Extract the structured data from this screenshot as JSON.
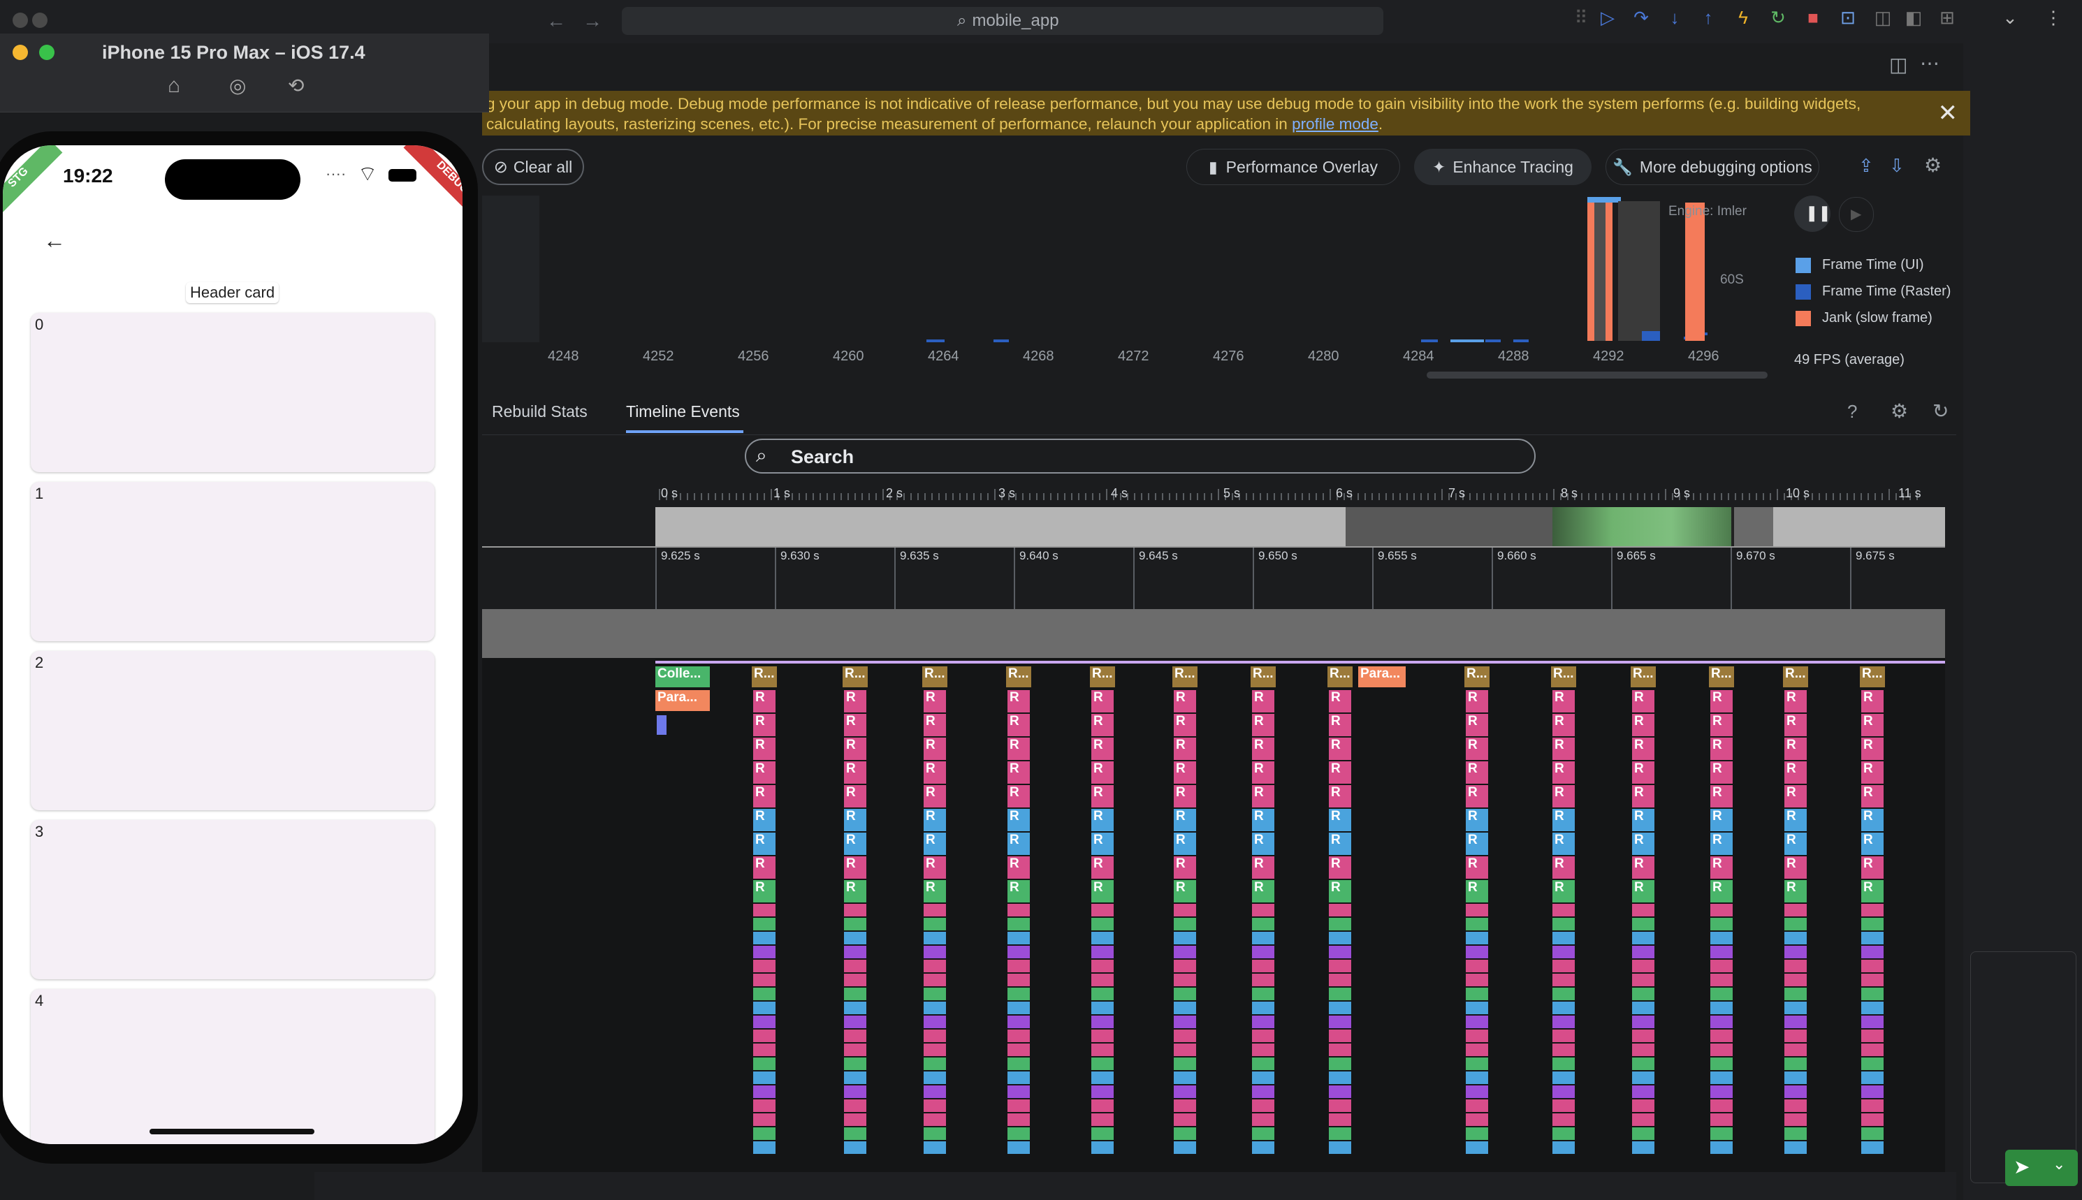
{
  "ide": {
    "search_text": "mobile_app",
    "colors": {
      "accent_blue": "#4a78d8",
      "run_green": "#5fb865",
      "stop_red": "#e05555",
      "hot_orange": "#f0b429"
    }
  },
  "simulator": {
    "title": "iPhone 15 Pro Max – iOS 17.4",
    "toolbar_icons": [
      "home-icon",
      "screenshot-icon",
      "rotate-icon"
    ]
  },
  "phone_app": {
    "time": "19:22",
    "banner_left": "STG",
    "banner_right": "DEBUG",
    "header_card": "Header card",
    "cards": [
      "0",
      "1",
      "2",
      "3",
      "4"
    ]
  },
  "banner": {
    "text": "g your app in debug mode. Debug mode performance is not indicative of release performance, but you may use debug mode to gain visibility into the work the system performs (e.g. building widgets, calculating layouts, rasterizing scenes, etc.). For precise measurement of performance, relaunch your application in",
    "link": "profile mode",
    "link_suffix": "."
  },
  "toolbar": {
    "clear_all": "Clear all",
    "performance_overlay": "Performance Overlay",
    "enhance_tracing": "Enhance Tracing",
    "more_debugging": "More debugging options"
  },
  "frame_chart": {
    "engine_label": "Engine: Im",
    "engine_suffix": "ler",
    "fps_marker": "60",
    "fps_marker_suffix": "S",
    "ticks": [
      "4248",
      "4252",
      "4256",
      "4260",
      "4264",
      "4268",
      "4272",
      "4276",
      "4280",
      "4284",
      "4288",
      "4292",
      "4296"
    ],
    "legend": [
      {
        "label": "Frame Time (UI)",
        "color": "#5aa0e8"
      },
      {
        "label": "Frame Time (Raster)",
        "color": "#2b5fc0"
      },
      {
        "label": "Jank (slow frame)",
        "color": "#f47b5a"
      }
    ],
    "fps_average": "49 FPS (average)"
  },
  "tabs": {
    "rebuild_stats": "Rebuild Stats",
    "timeline_events": "Timeline Events"
  },
  "timeline": {
    "search_placeholder": "Search",
    "overview_ticks": [
      "0 s",
      "1 s",
      "2 s",
      "3 s",
      "4 s",
      "5 s",
      "6 s",
      "7 s",
      "8 s",
      "9 s",
      "10 s",
      "11 s"
    ],
    "detail_ticks": [
      "9.625 s",
      "9.630 s",
      "9.635 s",
      "9.640 s",
      "9.645 s",
      "9.650 s",
      "9.655 s",
      "9.660 s",
      "9.665 s",
      "9.670 s",
      "9.675 s"
    ],
    "first_labels": [
      "Colle...",
      "Para..."
    ],
    "mid_label": "Para..."
  }
}
